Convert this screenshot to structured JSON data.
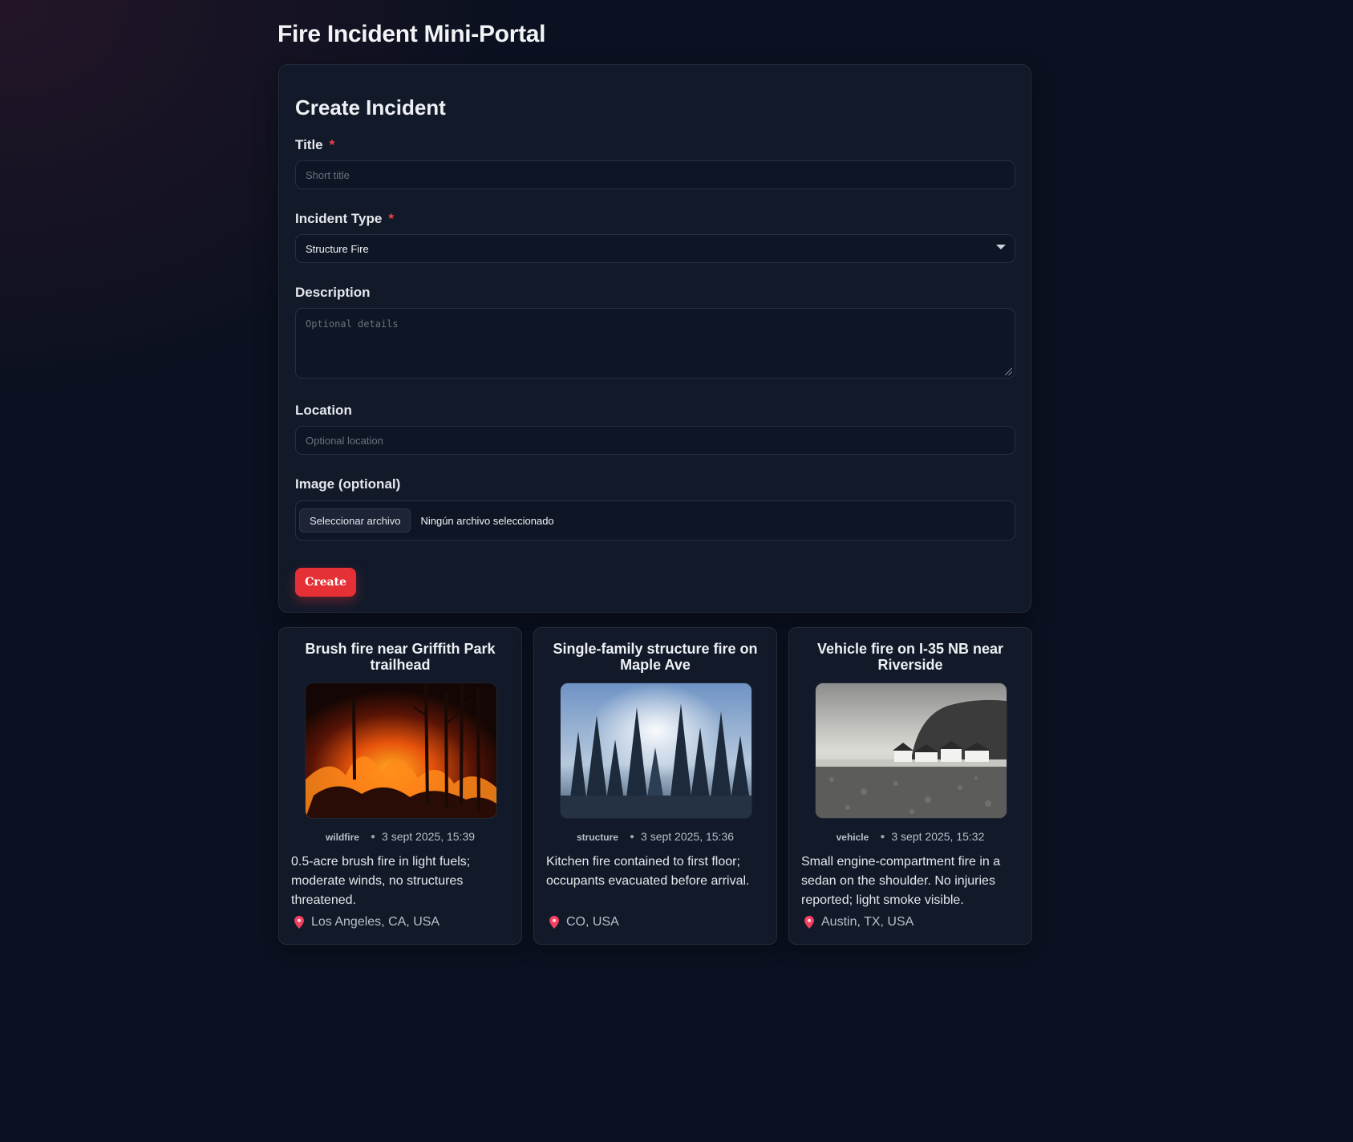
{
  "app": {
    "title": "Fire Incident Mini-Portal"
  },
  "form": {
    "heading": "Create Incident",
    "title_label": "Title",
    "title_placeholder": "Short title",
    "type_label": "Incident Type",
    "type_value": "Structure Fire",
    "description_label": "Description",
    "description_placeholder": "Optional details",
    "location_label": "Location",
    "location_placeholder": "Optional location",
    "image_label": "Image (optional)",
    "file_button_label": "Seleccionar archivo",
    "file_status": "Ningún archivo seleccionado",
    "submit_label": "Create",
    "required_marker": "*"
  },
  "incidents": [
    {
      "title": "Brush fire near Griffith Park trailhead",
      "type": "wildfire",
      "timestamp": "3 sept 2025, 15:39",
      "description": "0.5-acre brush fire in light fuels; moderate winds, no structures threatened.",
      "location": "Los Angeles, CA, USA",
      "image_icon": "wildfire-photo"
    },
    {
      "title": "Single-family structure fire on Maple Ave",
      "type": "structure",
      "timestamp": "3 sept 2025, 15:36",
      "description": "Kitchen fire contained to first floor; occupants evacuated before arrival.",
      "location": "CO, USA",
      "image_icon": "forest-photo"
    },
    {
      "title": "Vehicle fire on I-35 NB near Riverside",
      "type": "vehicle",
      "timestamp": "3 sept 2025, 15:32",
      "description": "Small engine-compartment fire in a sedan on the shoulder. No injuries reported; light smoke visible.",
      "location": "Austin, TX, USA",
      "image_icon": "coastal-cliff-photo"
    }
  ],
  "colors": {
    "background": "#0b1120",
    "card": "#121a2a",
    "accent": "#e53036",
    "required": "#ef4444",
    "pin": "#f43f5e"
  }
}
